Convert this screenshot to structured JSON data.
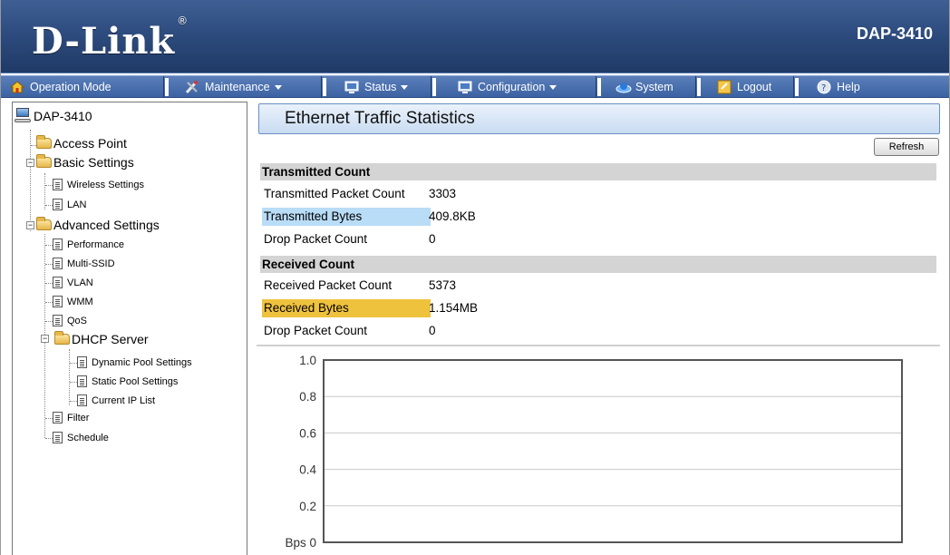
{
  "header": {
    "brand": "D-Link",
    "registered": "®",
    "model": "DAP-3410"
  },
  "menu": {
    "items": [
      {
        "label": "Operation Mode",
        "icon": "home-icon",
        "dropdown": false
      },
      {
        "label": "Maintenance",
        "icon": "tools-icon",
        "dropdown": true
      },
      {
        "label": "Status",
        "icon": "monitor-icon",
        "dropdown": true
      },
      {
        "label": "Configuration",
        "icon": "monitor-icon",
        "dropdown": true
      },
      {
        "label": "System",
        "icon": "globe-icon",
        "dropdown": false
      },
      {
        "label": "Logout",
        "icon": "logout-icon",
        "dropdown": false
      },
      {
        "label": "Help",
        "icon": "help-icon",
        "dropdown": false
      }
    ]
  },
  "sidebar": {
    "root": "DAP-3410",
    "access_point": "Access Point",
    "basic_settings": "Basic Settings",
    "wireless_settings": "Wireless Settings",
    "lan": "LAN",
    "advanced_settings": "Advanced Settings",
    "performance": "Performance",
    "multi_ssid": "Multi-SSID",
    "vlan": "VLAN",
    "wmm": "WMM",
    "qos": "QoS",
    "dhcp_server": "DHCP Server",
    "dynamic_pool": "Dynamic Pool Settings",
    "static_pool": "Static Pool Settings",
    "current_ip_list": "Current IP List",
    "filter": "Filter",
    "schedule": "Schedule",
    "expand_symbol": "−"
  },
  "main": {
    "title": "Ethernet Traffic Statistics",
    "refresh_label": "Refresh",
    "transmitted": {
      "heading": "Transmitted Count",
      "packet_label": "Transmitted Packet Count",
      "packet_value": "3303",
      "bytes_label": "Transmitted Bytes",
      "bytes_value": "409.8KB",
      "drop_label": "Drop Packet Count",
      "drop_value": "0"
    },
    "received": {
      "heading": "Received Count",
      "packet_label": "Received Packet Count",
      "packet_value": "5373",
      "bytes_label": "Received Bytes",
      "bytes_value": "1.154MB",
      "drop_label": "Drop Packet Count",
      "drop_value": "0"
    },
    "highlight_colors": {
      "transmitted": "#b9dcf7",
      "received": "#efc23e"
    }
  },
  "chart_data": {
    "type": "line",
    "title": "",
    "xlabel": "",
    "ylabel": "",
    "ylim": [
      0,
      1.0
    ],
    "yticks": [
      "Bps 0",
      "0.2",
      "0.4",
      "0.6",
      "0.8",
      "1.0"
    ],
    "grid": true,
    "series": []
  }
}
